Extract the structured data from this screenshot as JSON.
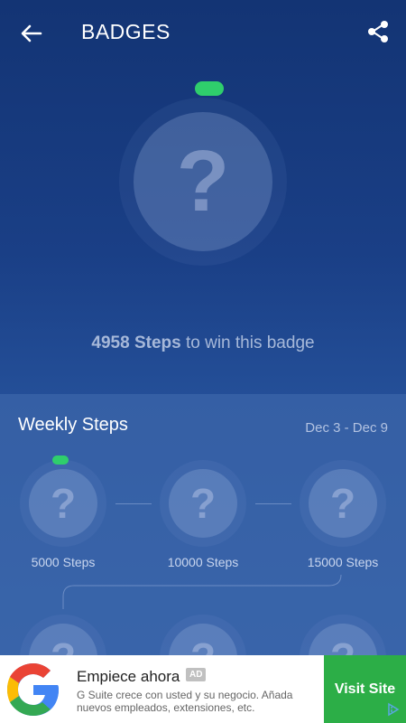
{
  "header": {
    "title": "BADGES",
    "back_icon": "arrow-left-icon",
    "share_icon": "share-icon"
  },
  "hero": {
    "badge_glyph": "?",
    "steps_needed": "4958 Steps",
    "suffix": " to win this badge",
    "progress_color": "#2fce6c"
  },
  "weekly": {
    "title": "Weekly Steps",
    "date_range": "Dec 3 - Dec 9",
    "badges": [
      {
        "label": "5000 Steps",
        "glyph": "?",
        "in_progress": true
      },
      {
        "label": "10000 Steps",
        "glyph": "?",
        "in_progress": false
      },
      {
        "label": "15000 Steps",
        "glyph": "?",
        "in_progress": false
      },
      {
        "glyph": "?"
      },
      {
        "glyph": "?"
      },
      {
        "glyph": "?"
      }
    ]
  },
  "ad": {
    "title": "Empiece ahora",
    "tag": "AD",
    "description": "G Suite crece con usted y su negocio. Añada nuevos empleados, extensiones, etc.",
    "cta": "Visit Site",
    "logo_icon": "google-logo-icon",
    "info_icon": "adchoices-icon",
    "cta_color": "#2cae47"
  }
}
